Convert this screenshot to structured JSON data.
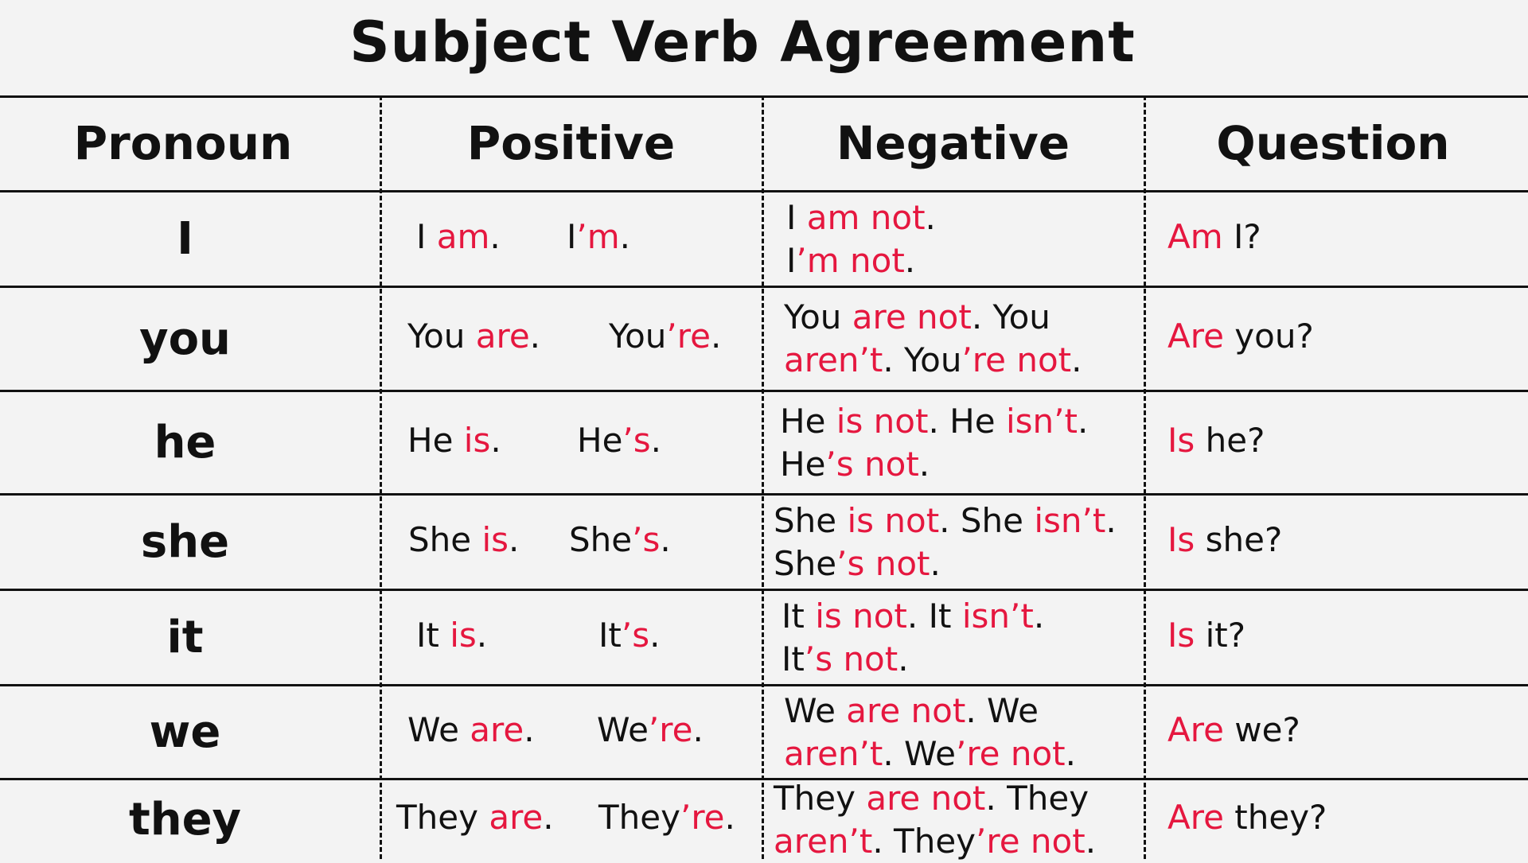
{
  "title": "Subject Verb Agreement",
  "colors": {
    "accent": "#e5173f",
    "text": "#111111",
    "background": "#f3f3f3"
  },
  "headers": [
    "Pronoun",
    "Positive",
    "Negative",
    "Question"
  ],
  "rows": [
    {
      "pronoun": "I",
      "positive": [
        [
          {
            "t": "I ",
            "r": false
          },
          {
            "t": "am",
            "r": true
          },
          {
            "t": ".",
            "r": false
          }
        ],
        [
          {
            "t": "I",
            "r": false
          },
          {
            "t": "’m",
            "r": true
          },
          {
            "t": ".",
            "r": false
          }
        ]
      ],
      "negative": [
        [
          {
            "t": "I ",
            "r": false
          },
          {
            "t": "am not",
            "r": true
          },
          {
            "t": ".",
            "r": false
          }
        ],
        [
          {
            "t": "I",
            "r": false
          },
          {
            "t": "’m not",
            "r": true
          },
          {
            "t": ".",
            "r": false
          }
        ]
      ],
      "question": [
        {
          "t": "Am",
          "r": true
        },
        {
          "t": " I?",
          "r": false
        }
      ]
    },
    {
      "pronoun": "you",
      "positive": [
        [
          {
            "t": "You ",
            "r": false
          },
          {
            "t": "are",
            "r": true
          },
          {
            "t": ".",
            "r": false
          }
        ],
        [
          {
            "t": "You",
            "r": false
          },
          {
            "t": "’re",
            "r": true
          },
          {
            "t": ".",
            "r": false
          }
        ]
      ],
      "negative": [
        [
          {
            "t": "You ",
            "r": false
          },
          {
            "t": "are not",
            "r": true
          },
          {
            "t": ". You",
            "r": false
          }
        ],
        [
          {
            "t": "aren’t",
            "r": true
          },
          {
            "t": ". You",
            "r": false
          },
          {
            "t": "’re not",
            "r": true
          },
          {
            "t": ".",
            "r": false
          }
        ]
      ],
      "question": [
        {
          "t": "Are",
          "r": true
        },
        {
          "t": " you?",
          "r": false
        }
      ]
    },
    {
      "pronoun": "he",
      "positive": [
        [
          {
            "t": "He ",
            "r": false
          },
          {
            "t": "is",
            "r": true
          },
          {
            "t": ".",
            "r": false
          }
        ],
        [
          {
            "t": "He",
            "r": false
          },
          {
            "t": "’s",
            "r": true
          },
          {
            "t": ".",
            "r": false
          }
        ]
      ],
      "negative": [
        [
          {
            "t": "He ",
            "r": false
          },
          {
            "t": "is not",
            "r": true
          },
          {
            "t": ". He ",
            "r": false
          },
          {
            "t": "isn’t",
            "r": true
          },
          {
            "t": ".",
            "r": false
          }
        ],
        [
          {
            "t": "He",
            "r": false
          },
          {
            "t": "’s not",
            "r": true
          },
          {
            "t": ".",
            "r": false
          }
        ]
      ],
      "question": [
        {
          "t": "Is",
          "r": true
        },
        {
          "t": " he?",
          "r": false
        }
      ]
    },
    {
      "pronoun": "she",
      "positive": [
        [
          {
            "t": "She ",
            "r": false
          },
          {
            "t": "is",
            "r": true
          },
          {
            "t": ".",
            "r": false
          }
        ],
        [
          {
            "t": "She",
            "r": false
          },
          {
            "t": "’s",
            "r": true
          },
          {
            "t": ".",
            "r": false
          }
        ]
      ],
      "negative": [
        [
          {
            "t": "She ",
            "r": false
          },
          {
            "t": "is not",
            "r": true
          },
          {
            "t": ". She ",
            "r": false
          },
          {
            "t": "isn’t",
            "r": true
          },
          {
            "t": ".",
            "r": false
          }
        ],
        [
          {
            "t": "She",
            "r": false
          },
          {
            "t": "’s not",
            "r": true
          },
          {
            "t": ".",
            "r": false
          }
        ]
      ],
      "question": [
        {
          "t": "Is",
          "r": true
        },
        {
          "t": " she?",
          "r": false
        }
      ]
    },
    {
      "pronoun": "it",
      "positive": [
        [
          {
            "t": "It ",
            "r": false
          },
          {
            "t": "is",
            "r": true
          },
          {
            "t": ".",
            "r": false
          }
        ],
        [
          {
            "t": "It",
            "r": false
          },
          {
            "t": "’s",
            "r": true
          },
          {
            "t": ".",
            "r": false
          }
        ]
      ],
      "negative": [
        [
          {
            "t": "It ",
            "r": false
          },
          {
            "t": "is not",
            "r": true
          },
          {
            "t": ". It ",
            "r": false
          },
          {
            "t": "isn’t",
            "r": true
          },
          {
            "t": ".",
            "r": false
          }
        ],
        [
          {
            "t": "It",
            "r": false
          },
          {
            "t": "’s not",
            "r": true
          },
          {
            "t": ".",
            "r": false
          }
        ]
      ],
      "question": [
        {
          "t": "Is",
          "r": true
        },
        {
          "t": " it?",
          "r": false
        }
      ]
    },
    {
      "pronoun": "we",
      "positive": [
        [
          {
            "t": "We ",
            "r": false
          },
          {
            "t": "are",
            "r": true
          },
          {
            "t": ".",
            "r": false
          }
        ],
        [
          {
            "t": "We",
            "r": false
          },
          {
            "t": "’re",
            "r": true
          },
          {
            "t": ".",
            "r": false
          }
        ]
      ],
      "negative": [
        [
          {
            "t": "We ",
            "r": false
          },
          {
            "t": "are not",
            "r": true
          },
          {
            "t": ". We",
            "r": false
          }
        ],
        [
          {
            "t": "aren’t",
            "r": true
          },
          {
            "t": ". We",
            "r": false
          },
          {
            "t": "’re not",
            "r": true
          },
          {
            "t": ".",
            "r": false
          }
        ]
      ],
      "question": [
        {
          "t": "Are",
          "r": true
        },
        {
          "t": " we?",
          "r": false
        }
      ]
    },
    {
      "pronoun": "they",
      "positive": [
        [
          {
            "t": "They ",
            "r": false
          },
          {
            "t": "are",
            "r": true
          },
          {
            "t": ".",
            "r": false
          }
        ],
        [
          {
            "t": "They",
            "r": false
          },
          {
            "t": "’re",
            "r": true
          },
          {
            "t": ".",
            "r": false
          }
        ]
      ],
      "negative": [
        [
          {
            "t": "They ",
            "r": false
          },
          {
            "t": "are not",
            "r": true
          },
          {
            "t": ". They",
            "r": false
          }
        ],
        [
          {
            "t": "aren’t",
            "r": true
          },
          {
            "t": ". They",
            "r": false
          },
          {
            "t": "’re not",
            "r": true
          },
          {
            "t": ".",
            "r": false
          }
        ]
      ],
      "question": [
        {
          "t": "Are",
          "r": true
        },
        {
          "t": " they?",
          "r": false
        }
      ]
    }
  ]
}
